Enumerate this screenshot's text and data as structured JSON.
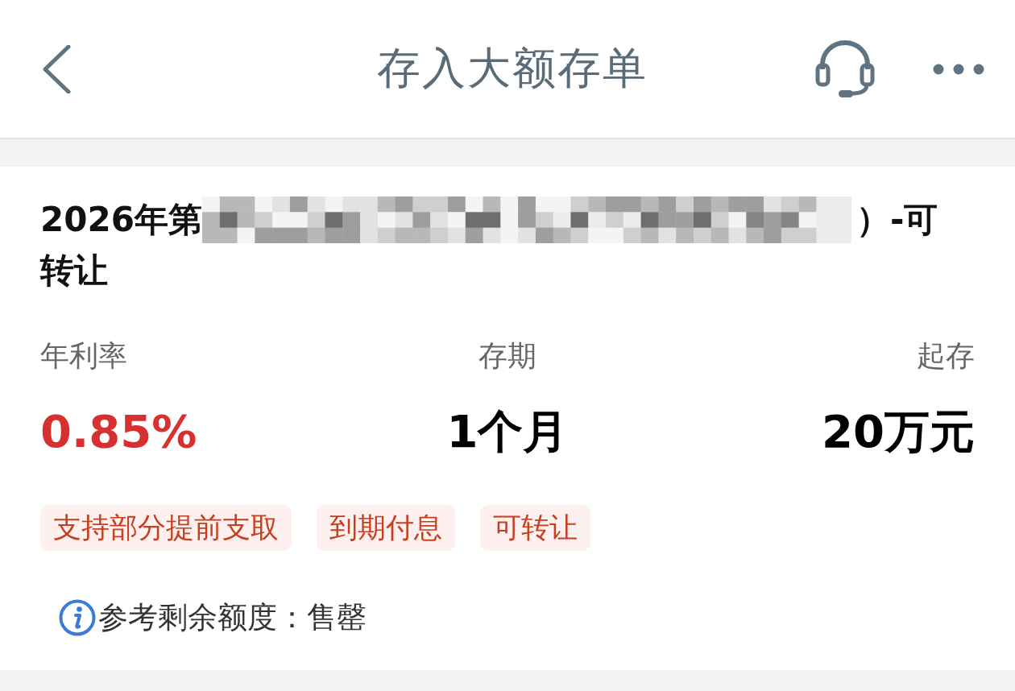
{
  "header": {
    "title": "存入大额存单"
  },
  "product": {
    "title_lines": [
      {
        "parts": [
          {
            "kind": "text",
            "text": "2026年第"
          },
          {
            "kind": "redaction"
          },
          {
            "kind": "text",
            "text": "）-可"
          }
        ]
      },
      {
        "parts": [
          {
            "kind": "text",
            "text": "转让"
          }
        ]
      }
    ],
    "stats": [
      {
        "label": "年利率",
        "value": "0.85%",
        "color": "#d8302f"
      },
      {
        "label": "存期",
        "value": "1个月",
        "color": "#000000"
      },
      {
        "label": "起存",
        "value": "20万元",
        "color": "#000000"
      }
    ],
    "tags": [
      "支持部分提前支取",
      "到期付息",
      "可转让"
    ],
    "quota_note": "参考剩余额度：售罄"
  }
}
